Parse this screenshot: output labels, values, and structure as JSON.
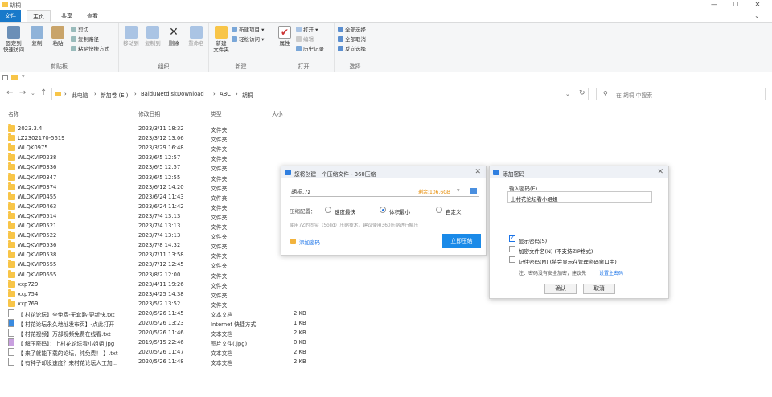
{
  "window": {
    "title": "胡桐"
  },
  "tabs": {
    "file": "文件",
    "home": "主页",
    "share": "共享",
    "view": "查看"
  },
  "ribbon": {
    "clipboard": {
      "label": "剪贴板",
      "pin": "固定到\n快速访问",
      "copy": "复制",
      "paste": "粘贴",
      "cut": "剪切",
      "copy_path": "复制路径",
      "paste_shortcut": "粘贴快捷方式"
    },
    "organize": {
      "label": "组织",
      "move_to": "移动到",
      "copy_to": "复制到",
      "delete": "删除",
      "rename": "重命名"
    },
    "new": {
      "label": "新建",
      "new_folder": "新建\n文件夹",
      "new_item": "新建项目 ▾",
      "easy_access": "轻松访问 ▾"
    },
    "open": {
      "label": "打开",
      "properties": "属性",
      "open": "打开 ▾",
      "edit": "编辑",
      "history": "历史记录"
    },
    "select": {
      "label": "选择",
      "select_all": "全部选择",
      "select_none": "全部取消",
      "invert": "反向选择"
    }
  },
  "address": {
    "crumbs": [
      "此电脑",
      "新加卷 (E:)",
      "BaiduNetdiskDownload",
      "ABC",
      "胡桐"
    ],
    "search_placeholder": "在 胡桐 中搜索"
  },
  "columns": {
    "name": "名称",
    "date": "修改日期",
    "type": "类型",
    "size": "大小"
  },
  "files": [
    {
      "name": "2023.3.4",
      "date": "2023/3/11 18:32",
      "type": "文件夹",
      "size": "",
      "kind": "folder"
    },
    {
      "name": "LZ2302170-5619",
      "date": "2023/3/12 13:06",
      "type": "文件夹",
      "size": "",
      "kind": "folder"
    },
    {
      "name": "WLQK0975",
      "date": "2023/3/29 16:48",
      "type": "文件夹",
      "size": "",
      "kind": "folder"
    },
    {
      "name": "WLQKVIP0238",
      "date": "2023/6/5 12:57",
      "type": "文件夹",
      "size": "",
      "kind": "folder"
    },
    {
      "name": "WLQKVIP0336",
      "date": "2023/6/5 12:57",
      "type": "文件夹",
      "size": "",
      "kind": "folder"
    },
    {
      "name": "WLQKVIP0347",
      "date": "2023/6/5 12:55",
      "type": "文件夹",
      "size": "",
      "kind": "folder"
    },
    {
      "name": "WLQKVIP0374",
      "date": "2023/6/12 14:20",
      "type": "文件夹",
      "size": "",
      "kind": "folder"
    },
    {
      "name": "WLQKVIP0455",
      "date": "2023/6/24 11:43",
      "type": "文件夹",
      "size": "",
      "kind": "folder"
    },
    {
      "name": "WLQKVIP0463",
      "date": "2023/6/24 11:42",
      "type": "文件夹",
      "size": "",
      "kind": "folder"
    },
    {
      "name": "WLQKVIP0514",
      "date": "2023/7/4 13:13",
      "type": "文件夹",
      "size": "",
      "kind": "folder"
    },
    {
      "name": "WLQKVIP0521",
      "date": "2023/7/4 13:13",
      "type": "文件夹",
      "size": "",
      "kind": "folder"
    },
    {
      "name": "WLQKVIP0522",
      "date": "2023/7/4 13:13",
      "type": "文件夹",
      "size": "",
      "kind": "folder"
    },
    {
      "name": "WLQKVIP0536",
      "date": "2023/7/8 14:32",
      "type": "文件夹",
      "size": "",
      "kind": "folder"
    },
    {
      "name": "WLQKVIP0538",
      "date": "2023/7/11 13:58",
      "type": "文件夹",
      "size": "",
      "kind": "folder"
    },
    {
      "name": "WLQKVIP0555",
      "date": "2023/7/12 12:45",
      "type": "文件夹",
      "size": "",
      "kind": "folder"
    },
    {
      "name": "WLQKVIP0655",
      "date": "2023/8/2 12:00",
      "type": "文件夹",
      "size": "",
      "kind": "folder"
    },
    {
      "name": "xxp729",
      "date": "2023/4/11 19:26",
      "type": "文件夹",
      "size": "",
      "kind": "folder"
    },
    {
      "name": "xxp754",
      "date": "2023/4/25 14:38",
      "type": "文件夹",
      "size": "",
      "kind": "folder"
    },
    {
      "name": "xxp769",
      "date": "2023/5/2 13:52",
      "type": "文件夹",
      "size": "",
      "kind": "folder"
    },
    {
      "name": "【 村花论坛】全免费-无套路-更新快.txt",
      "date": "2020/5/26 11:45",
      "type": "文本文档",
      "size": "2 KB",
      "kind": "txt"
    },
    {
      "name": "【 村花论坛永久地址发布页】-点此打开",
      "date": "2020/5/26 13:23",
      "type": "Internet 快捷方式",
      "size": "1 KB",
      "kind": "url"
    },
    {
      "name": "【 村花视频】万部视频免费在线看.txt",
      "date": "2020/5/26 11:46",
      "type": "文本文档",
      "size": "2 KB",
      "kind": "txt"
    },
    {
      "name": "【 解压密码】：上村花论坛看小姐姐.jpg",
      "date": "2019/5/15 22:46",
      "type": "图片文件(.jpg)",
      "size": "0 KB",
      "kind": "img"
    },
    {
      "name": "【 来了就能下载的论坛，纯免费！ 】.txt",
      "date": "2020/5/26 11:47",
      "type": "文本文档",
      "size": "2 KB",
      "kind": "txt"
    },
    {
      "name": "【 有种子却没速度？来村花论坛人工加...",
      "date": "2020/5/26 11:48",
      "type": "文本文档",
      "size": "2 KB",
      "kind": "txt"
    }
  ],
  "compress_dialog": {
    "title": "您将创建一个压缩文件 - 360压缩",
    "filename": "胡桐.7z",
    "free_space": "剩余:106.6GB",
    "config_label": "压缩配置：",
    "options": [
      "速度最快",
      "体积最小",
      "自定义"
    ],
    "selected": 1,
    "hint": "使用7Z的固实（Solid）压缩技术，建议使用360压缩进行解压",
    "add_password": "添加密码",
    "start_button": "立即压缩"
  },
  "password_dialog": {
    "title": "添加密码",
    "input_label": "输入密码(E)",
    "password": "上村花论坛看小姐姐",
    "show_password": "显示密码(S)",
    "encrypt_names": "加密文件名(N) (不支持ZIP格式)",
    "remember": "记住密码(M) (将会显示在管理密码窗口中)",
    "note": "注：密码没有安全加密，建议先",
    "note_link": "设置主密码",
    "ok": "确认",
    "cancel": "取消",
    "checked": {
      "show": true,
      "encrypt": false,
      "remember": false
    }
  }
}
